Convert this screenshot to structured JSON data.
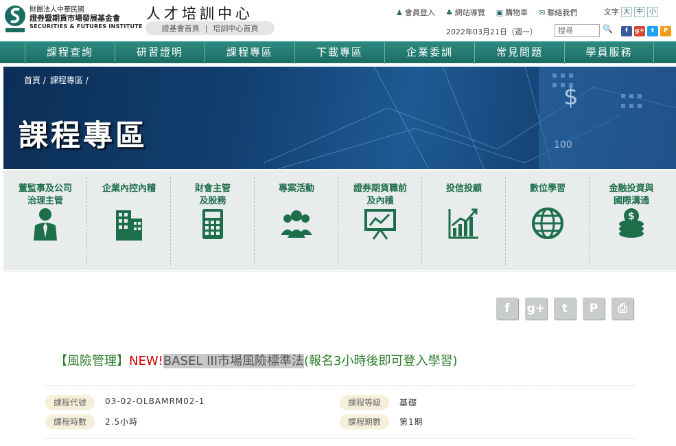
{
  "header": {
    "org_line1": "財團法人中華民國",
    "org_line2": "證券暨期貨市場發展基金會",
    "org_line3": "SECURITIES & FUTURES INSTITUTE",
    "site_title": "人才培訓中心",
    "crumb_links": [
      "證基會首頁",
      "|",
      "培訓中心首頁"
    ],
    "utils": [
      {
        "icon": "member-icon",
        "glyph": "♟",
        "label": "會員登入"
      },
      {
        "icon": "sitemap-icon",
        "glyph": "♣",
        "label": "網站導覽"
      },
      {
        "icon": "cart-icon",
        "glyph": "▣",
        "label": "購物車"
      },
      {
        "icon": "contact-icon",
        "glyph": "✉",
        "label": "聯絡我們"
      }
    ],
    "font_size_label": "文字",
    "font_sizes": [
      "大",
      "中",
      "小"
    ],
    "date": "2022年03月21日（週一）",
    "search_placeholder": "搜尋",
    "social": [
      {
        "icon": "facebook-icon",
        "glyph": "f",
        "color": "#3b5998"
      },
      {
        "icon": "googleplus-icon",
        "glyph": "g+",
        "color": "#d34836"
      },
      {
        "icon": "twitter-icon",
        "glyph": "t",
        "color": "#1da1f2"
      },
      {
        "icon": "plurk-icon",
        "glyph": "P",
        "color": "#f39c12"
      }
    ]
  },
  "nav": [
    "課程查詢",
    "研習證明",
    "課程專區",
    "下載專區",
    "企業委訓",
    "常見問題",
    "學員服務"
  ],
  "banner": {
    "breadcrumb": [
      "首頁 /",
      "課程專區 /"
    ],
    "title": "課程專區"
  },
  "categories": [
    {
      "label": "董監事及公司\n治理主管",
      "icon": "director-icon"
    },
    {
      "label": "企業內控內稽",
      "icon": "building-icon"
    },
    {
      "label": "財會主管\n及股務",
      "icon": "calculator-icon"
    },
    {
      "label": "專案活動",
      "icon": "group-icon"
    },
    {
      "label": "證券期貨職前\n及內稽",
      "icon": "presentation-icon"
    },
    {
      "label": "投信投顧",
      "icon": "growth-chart-icon"
    },
    {
      "label": "數位學習",
      "icon": "globe-icon"
    },
    {
      "label": "金融投資與\n國際溝通",
      "icon": "coins-icon"
    }
  ],
  "share": [
    {
      "icon": "share-facebook-icon",
      "glyph": "f"
    },
    {
      "icon": "share-googleplus-icon",
      "glyph": "g+"
    },
    {
      "icon": "share-twitter-icon",
      "glyph": "t"
    },
    {
      "icon": "share-plurk-icon",
      "glyph": "P"
    },
    {
      "icon": "print-icon",
      "glyph": "⎙"
    }
  ],
  "course": {
    "category": "【風險管理】",
    "new_tag": "NEW!",
    "name_highlight": "BASEL III市場風險標準法",
    "note": "(報名3小時後即可登入學習)",
    "fields": {
      "code_label": "課程代號",
      "code_value": "03-02-OLBAMRM02-1",
      "level_label": "課程等級",
      "level_value": "基礎",
      "hours_label": "課程時數",
      "hours_value": "2.5小時",
      "period_label": "課程期數",
      "period_value": "第1期"
    }
  },
  "colors": {
    "nav_green": "#1b6c63",
    "category_green": "#1d6e4b",
    "new_red": "#d40000"
  }
}
